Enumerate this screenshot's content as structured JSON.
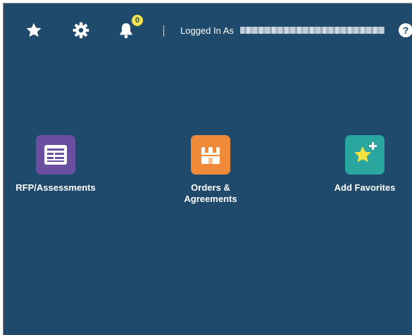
{
  "header": {
    "favorites_icon": "star-icon",
    "settings_icon": "gear-icon",
    "notifications_icon": "bell-icon",
    "notification_count": "0",
    "logged_in_label": "Logged In As",
    "help_label": "?"
  },
  "tiles": [
    {
      "label": "RFP/Assessments",
      "icon": "document-list-icon",
      "color": "#6a4fa0"
    },
    {
      "label": "Orders &\nAgreements",
      "icon": "package-icon",
      "color": "#ee8a3a"
    },
    {
      "label": "Add Favorites",
      "icon": "star-plus-icon",
      "color": "#2aa6a0"
    }
  ],
  "colors": {
    "background": "#1f4a6b",
    "badge": "#f4e34a"
  }
}
